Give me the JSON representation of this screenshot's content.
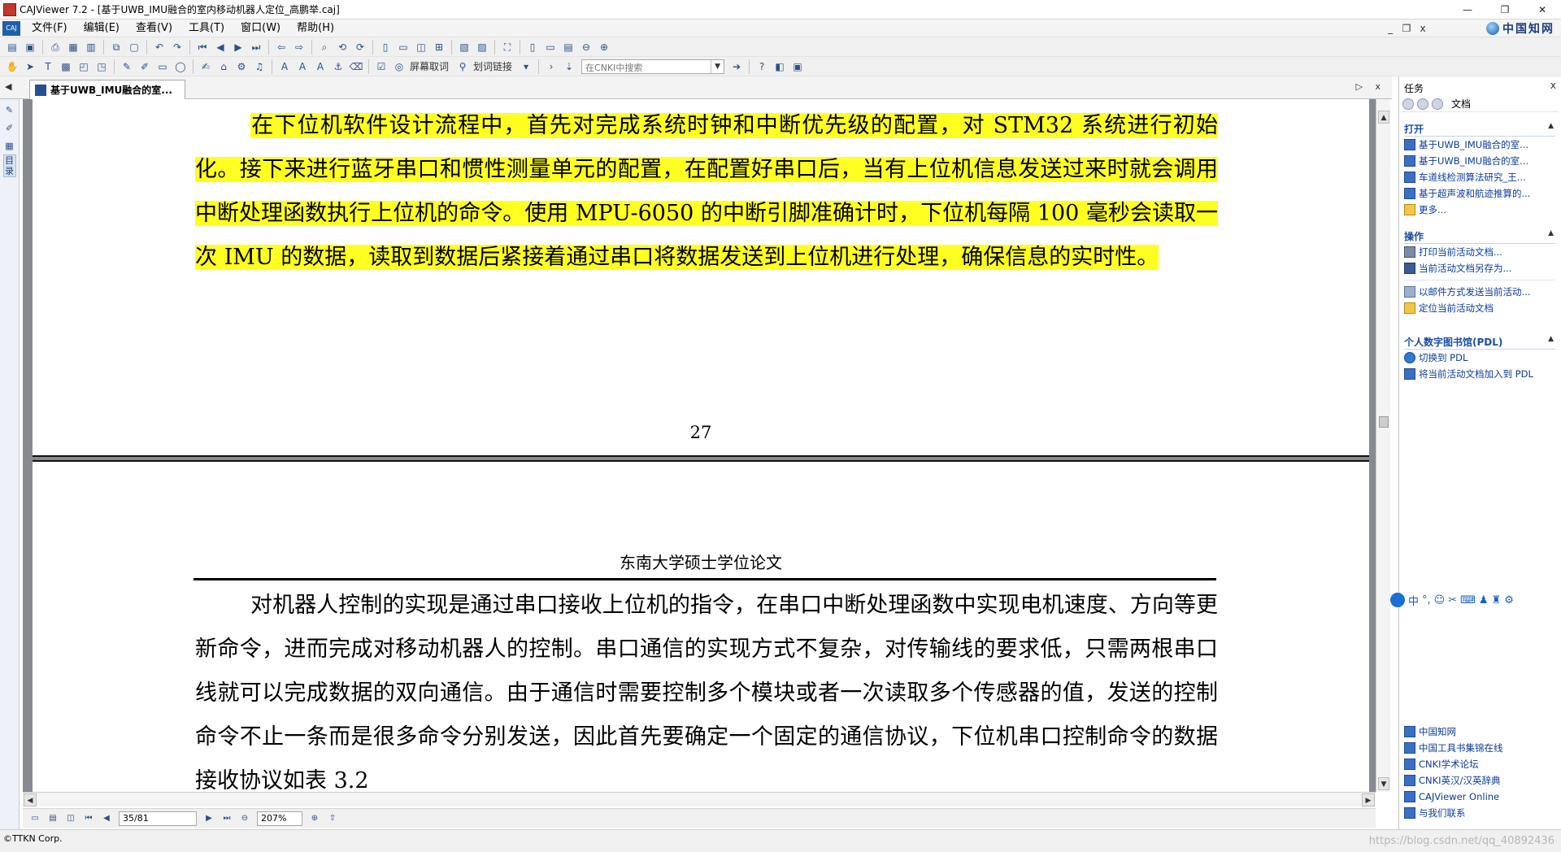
{
  "window": {
    "title": "CAJViewer 7.2 - [基于UWB_IMU融合的室内移动机器人定位_高鹏举.caj]",
    "controls": [
      "—",
      "❐",
      "✕"
    ]
  },
  "menubar": {
    "logo": "CAJ",
    "items": [
      "文件(F)",
      "编辑(E)",
      "查看(V)",
      "工具(T)",
      "窗口(W)",
      "帮助(H)"
    ],
    "mdi_controls": [
      "_",
      "❐",
      "x"
    ],
    "brand": "中国知网"
  },
  "toolbar2": {
    "screen_word": "屏幕取词",
    "word_link": "划词链接",
    "search_placeholder": "在CNKI中搜索"
  },
  "tab": {
    "label": "基于UWB_IMU融合的室...",
    "close": "x"
  },
  "left_strip": {
    "label": "目录"
  },
  "document": {
    "page_top": {
      "paragraph": "在下位机软件设计流程中，首先对完成系统时钟和中断优先级的配置，对 STM32 系统进行初始化。接下来进行蓝牙串口和惯性测量单元的配置，在配置好串口后，当有上位机信息发送过来时就会调用中断处理函数执行上位机的命令。使用 MPU-6050 的中断引脚准确计时，下位机每隔 100 毫秒会读取一次 IMU 的数据，读取到数据后紧接着通过串口将数据发送到上位机进行处理，确保信息的实时性。",
      "page_number": "27"
    },
    "page_bottom": {
      "running_header": "东南大学硕士学位论文",
      "paragraph": "对机器人控制的实现是通过串口接收上位机的指令，在串口中断处理函数中实现电机速度、方向等更新命令，进而完成对移动机器人的控制。串口通信的实现方式不复杂，对传输线的要求低，只需两根串口线就可以完成数据的双向通信。由于通信时需要控制多个模块或者一次读取多个传感器的值，发送的控制命令不止一条而是很多命令分别发送，因此首先要确定一个固定的通信协议，下位机串口控制命令的数据接收协议如表 3.2"
    }
  },
  "navbar": {
    "page": "35/81",
    "zoom": "207%"
  },
  "statusbar": {
    "text": "©TTKN Corp.",
    "watermark": "https://blog.csdn.net/qq_40892436"
  },
  "taskpane": {
    "title": "任务",
    "nav_label": "文档",
    "close": "x",
    "sections": {
      "open": {
        "title": "打开",
        "items": [
          "基于UWB_IMU融合的室...",
          "基于UWB_IMU融合的室...",
          "车道线检测算法研究_王...",
          "基于超声波和航迹推算的...",
          "更多..."
        ]
      },
      "actions": {
        "title": "操作",
        "items": [
          "打印当前活动文档...",
          "当前活动文档另存为...",
          "以邮件方式发送当前活动...",
          "定位当前活动文档"
        ]
      },
      "pdl": {
        "title": "个人数字图书馆(PDL)",
        "items": [
          "切换到 PDL",
          "将当前活动文档加入到 PDL"
        ]
      },
      "links": {
        "items": [
          "中国知网",
          "中国工具书集锦在线",
          "CNKI学术论坛",
          "CNKI英汉/汉英辞典",
          "CAJViewer Online",
          "与我们联系"
        ]
      }
    }
  },
  "ime": {
    "mode": "中"
  },
  "colors": {
    "highlight": "#ffff21",
    "link": "#0c3b9a",
    "section_title": "#1b4ea3",
    "doc_background": "#888a91"
  },
  "icons": [
    "open-icon",
    "save-icon",
    "print-icon",
    "undo-icon",
    "redo-icon",
    "first-page-icon",
    "prev-page-icon",
    "next-page-icon",
    "last-page-icon",
    "zoom-in-icon",
    "zoom-out-icon",
    "hand-tool-icon",
    "select-icon",
    "text-select-icon",
    "highlighter-icon",
    "search-go-icon",
    "help-icon"
  ]
}
